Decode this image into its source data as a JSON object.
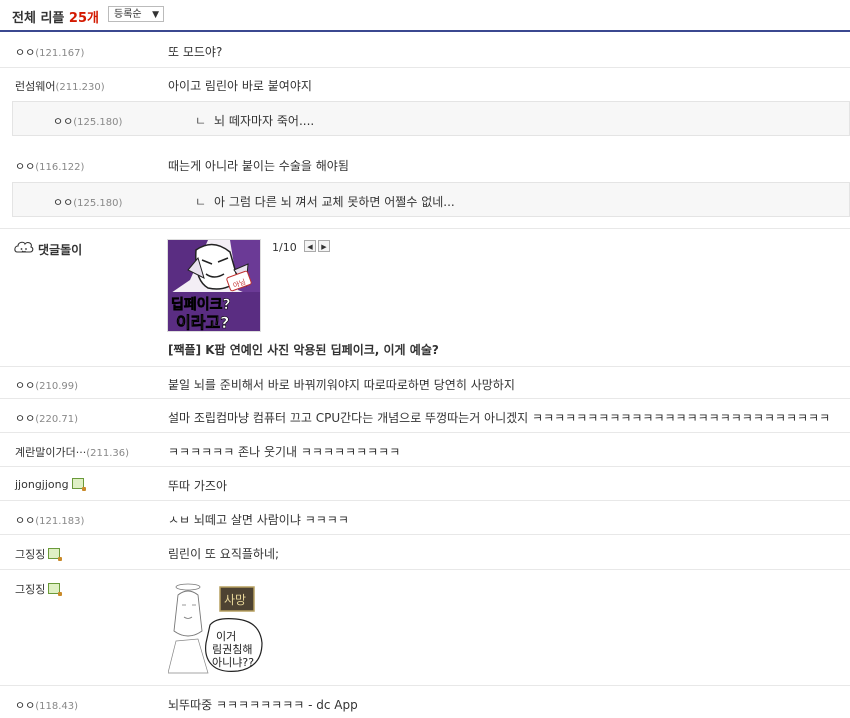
{
  "header": {
    "title_prefix": "전체 리플",
    "count": "25개",
    "sort_label": "등록순",
    "sort_arrow": "▼"
  },
  "comments": [
    {
      "nick": "ㅇㅇ",
      "ip": "(121.167)",
      "text": "또 모드야?"
    },
    {
      "nick": "런섬웨어",
      "ip": "(211.230)",
      "text": "아이고 림린아 바로 붙여야지"
    },
    {
      "nick": "ㅇㅇ",
      "ip": "(125.180)",
      "text": "뇌 떼자마자 죽어...."
    },
    {
      "nick": "ㅇㅇ",
      "ip": "(116.122)",
      "text": "때는게 아니라 붙이는 수술을 해야됨"
    },
    {
      "nick": "ㅇㅇ",
      "ip": "(125.180)",
      "text": "아 그럼 다른 뇌 껴서 교체 못하면 어쩔수 없네..."
    },
    {
      "nick": "ㅇㅇ",
      "ip": "(210.99)",
      "text": "붙일 뇌를 준비해서 바로 바꿔끼워야지 따로따로하면 당연히 사망하지"
    },
    {
      "nick": "ㅇㅇ",
      "ip": "(220.71)",
      "text": "설마 조립컴마냥 컴퓨터 끄고 CPU간다는 개념으로 뚜껑따는거 아니겠지 ㅋㅋㅋㅋㅋㅋㅋㅋㅋㅋㅋㅋㅋㅋㅋㅋㅋㅋㅋㅋㅋㅋㅋㅋㅋㅋㅋ"
    },
    {
      "nick": "계란말이가더···",
      "ip": "(211.36)",
      "text": "ㅋㅋㅋㅋㅋㅋ 존나 웃기내 ㅋㅋㅋㅋㅋㅋㅋㅋㅋ"
    },
    {
      "nick": "jjongjjong",
      "ip": "",
      "text": "뚜따 가즈아"
    },
    {
      "nick": "ㅇㅇ",
      "ip": "(121.183)",
      "text": "ㅅㅂ 뇌떼고 살면 사람이냐 ㅋㅋㅋㅋ"
    },
    {
      "nick": "그징징",
      "ip": "",
      "text": "림린이 또 요직플하네;"
    },
    {
      "nick": "그징징",
      "ip": "",
      "text": ""
    },
    {
      "nick": "ㅇㅇ",
      "ip": "(118.43)",
      "text": "뇌뚜따중 ㅋㅋㅋㅋㅋㅋㅋㅋ - dc App"
    }
  ],
  "reply_arrow": "ㄴ",
  "ad": {
    "label": "댓글돌이",
    "page": "1/10",
    "prev": "◀",
    "next": "▶",
    "thumb_text_1": "딥페이크?",
    "thumb_text_2": "이라고?",
    "thumb_badge": "아님",
    "headline_tag": "[짹플]",
    "headline": "K팝 연예인 사진 악용된 딥페이크, 이게 예술?"
  },
  "image_comment": {
    "sign": "사망",
    "bubble_line1": "이거",
    "bubble_line2": "림권침해",
    "bubble_line3": "아니냐??"
  }
}
